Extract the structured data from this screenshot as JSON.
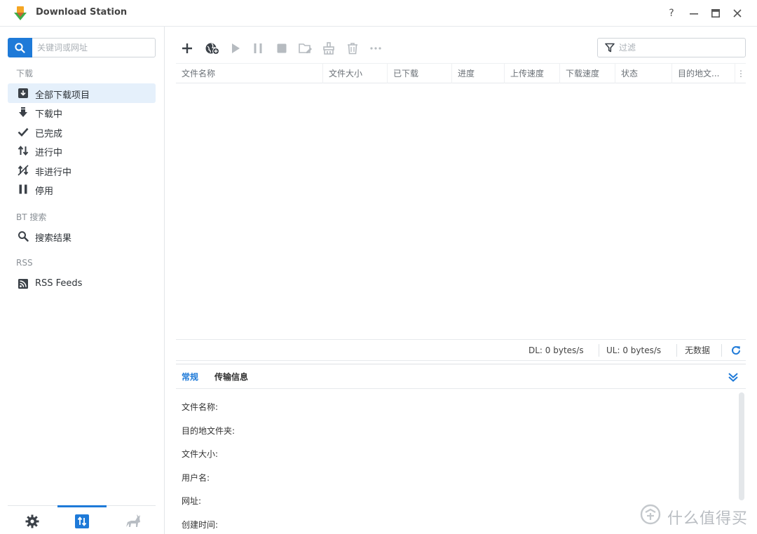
{
  "window": {
    "title": "Download Station",
    "help": "?",
    "minimize": "—",
    "maximize": "□",
    "close": "✕"
  },
  "sidebar": {
    "search_placeholder": "关键词或网址",
    "sections": {
      "download": "下载",
      "bt": "BT 搜索",
      "rss": "RSS"
    },
    "items": [
      {
        "label": "全部下载项目",
        "icon": "download-box-icon",
        "active": true
      },
      {
        "label": "下载中",
        "icon": "arrow-down-icon"
      },
      {
        "label": "已完成",
        "icon": "check-icon"
      },
      {
        "label": "进行中",
        "icon": "up-down-arrows-icon"
      },
      {
        "label": "非进行中",
        "icon": "inactive-icon"
      },
      {
        "label": "停用",
        "icon": "pause-icon"
      },
      {
        "label": "搜索结果",
        "icon": "search-icon"
      },
      {
        "label": "RSS Feeds",
        "icon": "rss-icon"
      }
    ],
    "footer": [
      "gear-icon",
      "transfer-icon",
      "bt-icon"
    ]
  },
  "toolbar": {
    "buttons": [
      "add-icon",
      "add-url-icon",
      "play-icon",
      "pause-icon",
      "stop-icon",
      "edit-destination-icon",
      "clear-icon",
      "delete-icon",
      "more-icon"
    ],
    "filter_placeholder": "过滤"
  },
  "grid": {
    "columns": [
      "文件名称",
      "文件大小",
      "已下载",
      "进度",
      "上传速度",
      "下载速度",
      "状态",
      "目的地文..."
    ],
    "rows": []
  },
  "status": {
    "dl": "DL: 0 bytes/s",
    "ul": "UL: 0 bytes/s",
    "no_data": "无数据"
  },
  "details": {
    "tabs": [
      "常规",
      "传输信息"
    ],
    "active_tab": 0,
    "fields": [
      "文件名称:",
      "目的地文件夹:",
      "文件大小:",
      "用户名:",
      "网址:",
      "创建时间:"
    ]
  },
  "watermark": "什么值得买",
  "colors": {
    "accent": "#1e7ad8",
    "active_bg": "#e5f0fb"
  }
}
